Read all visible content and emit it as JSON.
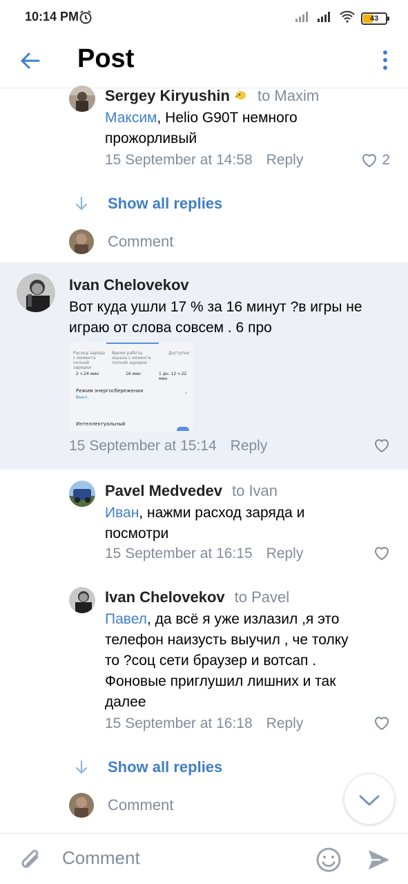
{
  "status_bar": {
    "time": "10:14 PM",
    "battery": "43"
  },
  "header": {
    "title": "Post"
  },
  "comments": [
    {
      "author": "Sergey Kiryushin",
      "to": "to Maxim",
      "mention": "Максим",
      "text_line1": ", Helio G90T немного",
      "text_line2": "прожорливый",
      "date": "15 September at 14:58",
      "reply": "Reply",
      "likes": "2"
    },
    {
      "author": "Ivan Chelovekov",
      "text_line1": "Вот куда ушли 17 % за 16 минут ?в игры не",
      "text_line2": "играю от слова совсем . 6 про",
      "date": "15 September at 15:14",
      "reply": "Reply"
    },
    {
      "author": "Pavel Medvedev",
      "to": "to Ivan",
      "mention": "Иван",
      "text_line1": ", нажми расход заряда и",
      "text_line2": "посмотри",
      "date": "15 September at 16:15",
      "reply": "Reply"
    },
    {
      "author": "Ivan Chelovekov",
      "to": "to Pavel",
      "mention": "Павел",
      "text_line1": ", да всё я уже излазил ,я это",
      "text_line2": "телефон наизусть выучил , че толку",
      "text_line3": "то ?соц сети браузер и вотсап .",
      "text_line4": "Фоновые приглушил лишних и так",
      "text_line5": "далее",
      "date": "15 September at 16:18",
      "reply": "Reply"
    }
  ],
  "thread1": {
    "show_all": "Show all replies",
    "comment_placeholder": "Comment"
  },
  "thread2": {
    "show_all": "Show all replies",
    "comment_placeholder": "Comment"
  },
  "attachment": {
    "col1": "Расход заряда с момента полной зарядки",
    "col2": "Время работы экрана с момента полной зарядки",
    "col3": "Доступно",
    "val1": "2 ч 24 мин",
    "val2": "16 мин",
    "val3": "1 дн. 12 ч 22 мин",
    "power_saving": "Режим энергосбережения",
    "power_saving_state": "Выкл.",
    "intellectual": "Интеллектуальный"
  },
  "input": {
    "placeholder": "Comment"
  },
  "colors": {
    "accent": "#3f7ec8",
    "secondary_text": "#818c99",
    "highlight_bg": "#edf1f7"
  }
}
